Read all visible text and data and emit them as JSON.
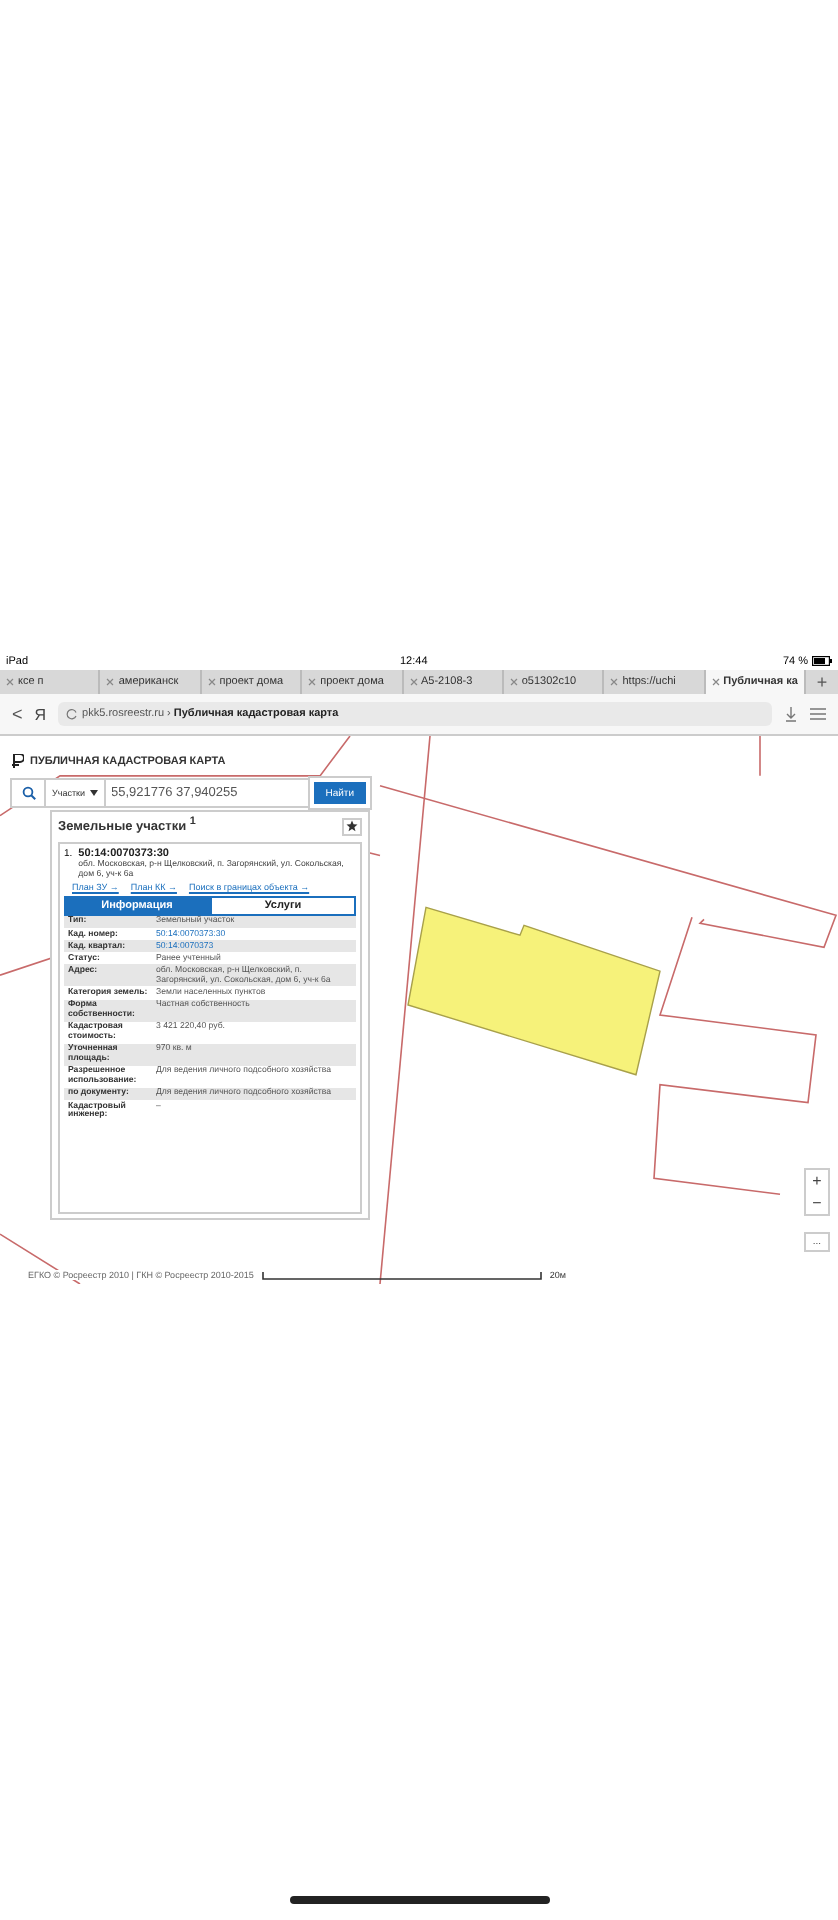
{
  "status_bar": {
    "device": "iPad",
    "time": "12:44",
    "battery": "74 %"
  },
  "browser_tabs": [
    {
      "label": "ксе п",
      "selected": false
    },
    {
      "label": "американск",
      "selected": false
    },
    {
      "label": "проект дома",
      "selected": false
    },
    {
      "label": "проект дома",
      "selected": false
    },
    {
      "label": "А5-2108-3",
      "selected": false
    },
    {
      "label": "о51302с10",
      "selected": false
    },
    {
      "label": "https://uchi",
      "selected": false
    },
    {
      "label": "Публичная ка",
      "selected": true
    }
  ],
  "new_tab": "+",
  "address_bar": {
    "back": "<",
    "logo": "Я",
    "domain": "pkk5.rosreestr.ru",
    "separator": "›",
    "page_title": "Публичная кадастровая карта"
  },
  "app": {
    "title": "ПУБЛИЧНАЯ КАДАСТРОВАЯ КАРТА",
    "search": {
      "type": "Участки",
      "value": "55,921776 37,940255",
      "button": "Найти"
    },
    "results": {
      "title": "Земельные участки $^{1}$",
      "item": {
        "number": "1.",
        "cad_number": "50:14:0070373:30",
        "address": "обл. Московская, р-н Щелковский, п. Загорянский, ул. Сокольская, дом 6, уч-к 6а",
        "links": [
          "План ЗУ →",
          "План КК →",
          "Поиск в границах объекта →"
        ]
      },
      "tabs": [
        {
          "label": "Информация",
          "selected": true
        },
        {
          "label": "Услуги",
          "selected": false
        }
      ],
      "rows": [
        {
          "label": "Тип:",
          "value": "Земельный участок",
          "kind": "text"
        },
        {
          "label": "Кад. номер:",
          "value": "50:14:0070373:30",
          "kind": "link"
        },
        {
          "label": "Кад. квартал:",
          "value": "50:14:0070373",
          "kind": "link"
        },
        {
          "label": "Статус:",
          "value": "Ранее учтенный",
          "kind": "text"
        },
        {
          "label": "Адрес:",
          "value": "обл. Московская, р-н Щелковский, п. Загорянский, ул. Сокольская, дом 6, уч-к 6а",
          "kind": "text"
        },
        {
          "label": "Категория земель:",
          "value": "Земли населенных пунктов",
          "kind": "text"
        },
        {
          "label": "Форма собственности:",
          "value": "Частная собственность",
          "kind": "text"
        },
        {
          "label": "Кадастровая стоимость:",
          "value": "3 421 220,40 руб.",
          "kind": "text"
        },
        {
          "label": "Уточненная площадь:",
          "value": "970 кв. м",
          "kind": "text"
        },
        {
          "label": "Разрешенное использование:",
          "value": "Для ведения личного подсобного хозяйства",
          "kind": "text"
        },
        {
          "label": "по документу:",
          "value": "Для ведения личного подсобного хозяйства",
          "kind": "text"
        },
        {
          "label": "Кадастровый инженер:",
          "value": "–",
          "kind": "text"
        }
      ]
    }
  },
  "map": {
    "zoom_in": "+",
    "zoom_out": "−",
    "more": "...",
    "scale": "20м",
    "attribution": "ЕГКО © Росреестр 2010 | ГКН © Росреестр 2010-2015"
  }
}
